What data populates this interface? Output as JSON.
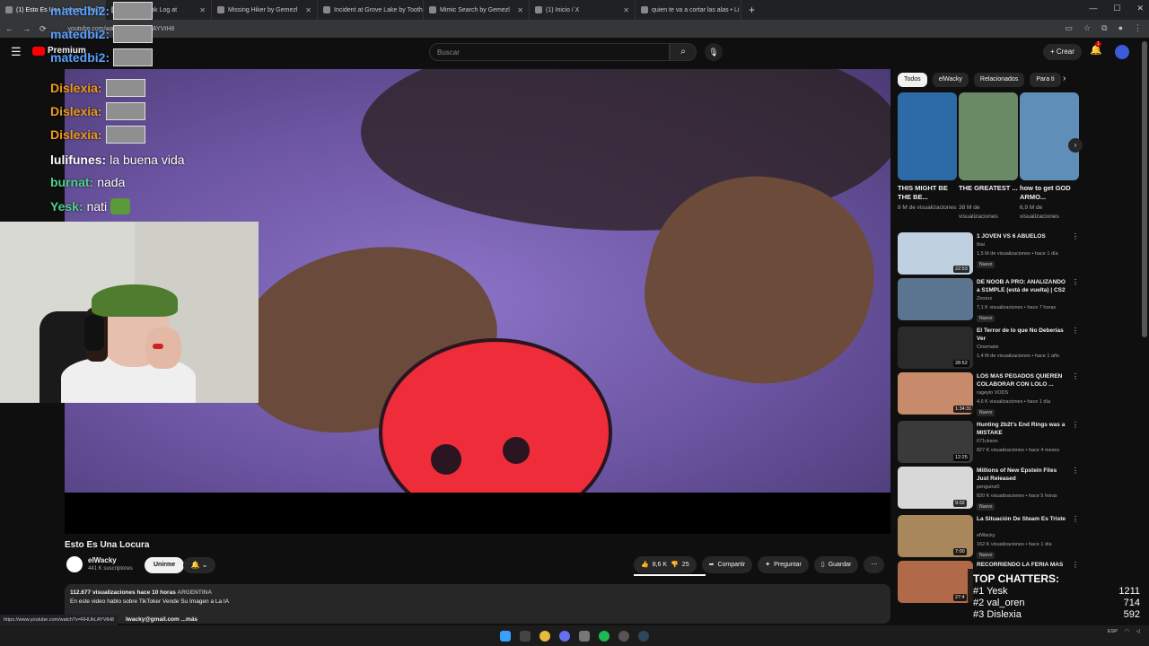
{
  "browser": {
    "tabs": [
      {
        "label": "(1) Esto Es Una Locura - YouTube",
        "active": true
      },
      {
        "label": "...erious Oak Log at",
        "active": false
      },
      {
        "label": "Missing Hiker by Gemezl",
        "active": false
      },
      {
        "label": "Incident at Grove Lake by Toothl",
        "active": false
      },
      {
        "label": "Mimic Search by Gemezl",
        "active": false
      },
      {
        "label": "(1) Inicio / X",
        "active": false
      },
      {
        "label": "quien te va a cortar las alas • Li",
        "active": false
      }
    ],
    "new_tab": "+",
    "url": "youtube.com/watch?v=RHUkLAYVtH8"
  },
  "youtube": {
    "logo_text": "Premium",
    "search_placeholder": "Buscar",
    "create_label": "Crear",
    "notif_count": "1"
  },
  "chat": {
    "lines": [
      {
        "user": "matedbi2:",
        "color": "#5aa0ff",
        "msg": "",
        "emote": true
      },
      {
        "user": "matedbi2:",
        "color": "#5aa0ff",
        "msg": "",
        "emote": true
      },
      {
        "user": "matedbi2:",
        "color": "#5aa0ff",
        "msg": "",
        "emote": true
      },
      {
        "user": "Dislexia:",
        "color": "#f09a1a",
        "msg": "",
        "emote": true
      },
      {
        "user": "Dislexia:",
        "color": "#f09a1a",
        "msg": "",
        "emote": true
      },
      {
        "user": "Dislexia:",
        "color": "#f09a1a",
        "msg": "",
        "emote": true
      },
      {
        "user": "lulifunes:",
        "color": "#ffffff",
        "msg": "la buena vida",
        "emote": false
      },
      {
        "user": "burnat:",
        "color": "#4fd08a",
        "msg": "nada",
        "emote": false
      },
      {
        "user": "Yesk:",
        "color": "#4fd08a",
        "msg": "nati",
        "emote": false
      }
    ]
  },
  "top_chatters": {
    "title": "TOP CHATTERS:",
    "rows": [
      {
        "rank": "#1",
        "name": "Yesk",
        "count": "1211"
      },
      {
        "rank": "#2",
        "name": "val_oren",
        "count": "714"
      },
      {
        "rank": "#3",
        "name": "Dislexia",
        "count": "592"
      }
    ]
  },
  "video": {
    "title": "Esto Es Una Locura",
    "channel": "elWacky",
    "subscribers": "441 K suscriptores",
    "join_label": "Unirme",
    "likes": "8,6 K",
    "dislikes": "25",
    "share_label": "Compartir",
    "ask_label": "Preguntar",
    "save_label": "Guardar",
    "views": "112.677 visualizaciones",
    "time": "hace 10 horas",
    "country": "ARGENTINA",
    "description": "En este video hablo sobre TikToker Vende Su Imagen a La IA",
    "email_frag": "lwacky@gmail.com",
    "more_label": "...más",
    "status_url": "https://www.youtube.com/watch?v=RHUkLAYVtH8"
  },
  "sidebar": {
    "chips": [
      "Todos",
      "elWacky",
      "Relacionados",
      "Para ti"
    ],
    "shorts": [
      {
        "title": "THIS MIGHT BE THE BE...",
        "views": "8 M de visualizaciones",
        "color": "#2c6aa8"
      },
      {
        "title": "THE GREATEST ...",
        "views": "38 M de visualizaciones",
        "color": "#6a8a66"
      },
      {
        "title": "how to get GOD ARMO...",
        "views": "6,9 M de visualizaciones",
        "color": "#5f8fb8"
      }
    ],
    "videos": [
      {
        "title": "1 JOVEN VS 6 ABUELOS",
        "channel": "Ibai",
        "views": "1,5 M de visualizaciones • hace 1 día",
        "badge": "Nuevo",
        "duration": "22:53",
        "color": "#bfd0e0"
      },
      {
        "title": "DE NOOB A PRO: ANALIZANDO a S1MPLE (está de vuelta) | CS2",
        "channel": "Znorux",
        "views": "7,1 K visualizaciones • hace 7 horas",
        "badge": "Nuevo",
        "duration": "",
        "color": "#5b7590"
      },
      {
        "title": "El Terror de lo que No Deberías Ver",
        "channel": "Cinematix",
        "views": "1,4 M de visualizaciones • hace 1 año",
        "badge": "",
        "duration": "28:52",
        "color": "#2a2a2a"
      },
      {
        "title": "LOS MAS PEGADOS QUIEREN COLABORAR CON LOLO ...",
        "channel": "rageylo VODS",
        "views": "4,6 K visualizaciones • hace 1 día",
        "badge": "Nuevo",
        "duration": "1:34:31",
        "color": "#c78a6a"
      },
      {
        "title": "Hunting 2b2t's End Rings was a MISTAKE",
        "channel": "671ckson",
        "views": "827 K visualizaciones • hace 4 meses",
        "badge": "",
        "duration": "12:25",
        "color": "#3a3a3a"
      },
      {
        "title": "Millions of New Epstein Files Just Released",
        "channel": "penguinz0",
        "views": "820 K visualizaciones • hace 5 horas",
        "badge": "Nuevo",
        "duration": "9:02",
        "color": "#d8d8d8"
      },
      {
        "title": "La Situación De Steam Es Triste",
        "channel": "elWacky",
        "views": "162 K visualizaciones • hace 1 día",
        "badge": "Nuevo",
        "duration": "7:00",
        "color": "#a8875c"
      },
      {
        "title": "RECORRIENDO LA FERIA MAS",
        "channel": "",
        "views": "",
        "badge": "",
        "duration": "27:4",
        "color": "#b06a4a"
      }
    ]
  }
}
